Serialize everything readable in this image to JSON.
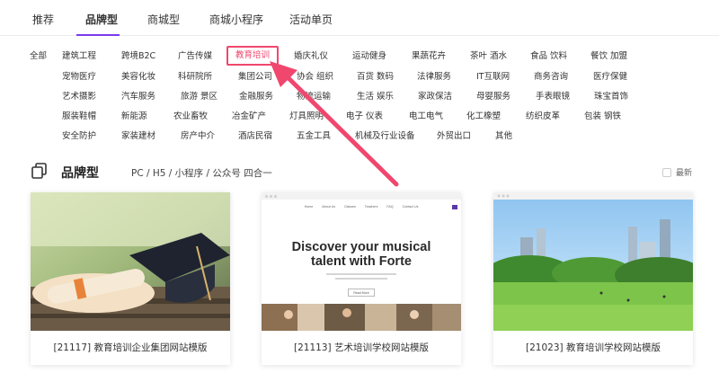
{
  "topnav": {
    "tabs": [
      {
        "label": "推荐",
        "active": false
      },
      {
        "label": "品牌型",
        "active": true
      },
      {
        "label": "商城型",
        "active": false
      },
      {
        "label": "商城小程序",
        "active": false
      },
      {
        "label": "活动单页",
        "active": false
      }
    ],
    "accent_color": "#7c3aed"
  },
  "categories": {
    "rows": [
      [
        "全部",
        "建筑工程",
        "跨境B2C",
        "广告传媒",
        "教育培训",
        "婚庆礼仪",
        "运动健身",
        "果蔬花卉",
        "茶叶 酒水",
        "食品 饮料",
        "餐饮 加盟"
      ],
      [
        "宠物医疗",
        "美容化妆",
        "科研院所",
        "集团公司",
        "协会 组织",
        "百货 数码",
        "法律服务",
        "IT互联网",
        "商务咨询",
        "医疗保健"
      ],
      [
        "艺术摄影",
        "汽车服务",
        "旅游 景区",
        "金融服务",
        "物流运输",
        "生活 娱乐",
        "家政保洁",
        "母婴服务",
        "手表眼镜",
        "珠宝首饰"
      ],
      [
        "服装鞋帽",
        "新能源",
        "农业畜牧",
        "冶金矿产",
        "灯具照明",
        "电子 仪表",
        "电工电气",
        "化工橡塑",
        "纺织皮革",
        "包装 钢铁"
      ],
      [
        "安全防护",
        "家装建材",
        "房产中介",
        "酒店民宿",
        "五金工具",
        "机械及行业设备",
        "外贸出口",
        "其他"
      ]
    ],
    "highlighted": "教育培训",
    "highlight_color": "#f0476e"
  },
  "section": {
    "icon": "copy-icon",
    "title": "品牌型",
    "subtitle": "PC / H5 / 小程序 / 公众号 四合一",
    "latest_label": "最新"
  },
  "templates": [
    {
      "caption": "[21117] 教育培训企业集团网站模版",
      "thumb": "graduation-cap-photo"
    },
    {
      "caption": "[21113] 艺术培训学校网站模版",
      "thumb": "music-school-site",
      "preview": {
        "headline1": "Discover your musical",
        "headline2": "talent with Forte",
        "nav": [
          "Home",
          "About Us",
          "Classes",
          "Teachers",
          "FAQ",
          "Contact Us"
        ],
        "button": "Read More"
      }
    },
    {
      "caption": "[21023] 教育培训学校网站模版",
      "thumb": "park-city-photo"
    }
  ]
}
